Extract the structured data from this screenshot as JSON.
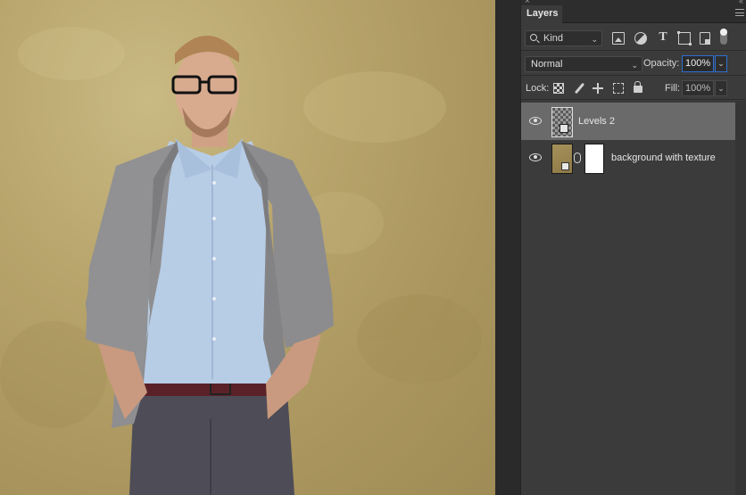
{
  "panel": {
    "close_glyph": "×",
    "collapse_glyph": "«",
    "tab_label": "Layers",
    "menu_icon": "panel-menu-icon"
  },
  "filter": {
    "kind_label": "Kind",
    "kind_icon": "search-icon",
    "icons": [
      "image-filter-icon",
      "adjustment-filter-icon",
      "type-filter-icon",
      "shape-filter-icon",
      "smart-object-filter-icon"
    ],
    "toggle_icon": "filter-toggle-icon"
  },
  "blend": {
    "mode": "Normal",
    "opacity_label": "Opacity:",
    "opacity_value": "100%"
  },
  "lock": {
    "label": "Lock:",
    "icons": [
      "lock-pixels-icon",
      "lock-image-pixels-icon",
      "lock-position-icon",
      "lock-artboard-icon",
      "lock-all-icon"
    ],
    "fill_label": "Fill:",
    "fill_value": "100%"
  },
  "layers": [
    {
      "name": "Levels 2",
      "selected": true,
      "visible": true
    },
    {
      "name": "background with texture",
      "selected": false,
      "visible": true
    }
  ],
  "colors": {
    "panel_bg": "#3b3b3b",
    "selected_row": "#6a6a6a",
    "focus_border": "#2f6fd1",
    "canvas_texture": "#b8a56c"
  }
}
